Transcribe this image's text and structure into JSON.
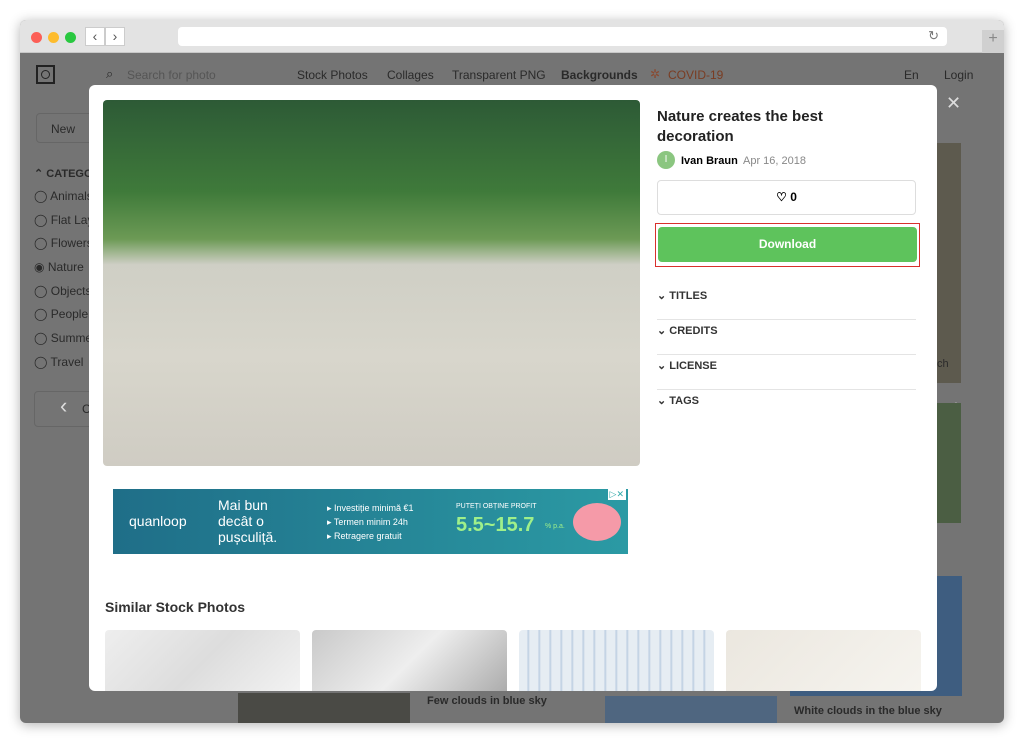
{
  "nav": {
    "search_placeholder": "Search for photo",
    "links": [
      "Stock Photos",
      "Collages",
      "Transparent PNG",
      "Backgrounds",
      "COVID-19"
    ],
    "lang": "En",
    "login": "Login"
  },
  "sidebar": {
    "new": "New",
    "categories_label": "CATEGO",
    "items": [
      "Animals",
      "Flat Lay",
      "Flowers",
      "Nature",
      "Objects",
      "People",
      "Summe",
      "Travel"
    ],
    "selected": "Nature",
    "button_partial": "C"
  },
  "background": {
    "captions": [
      "Few clouds in blue sky",
      "White clouds in the blue sky",
      "ch"
    ]
  },
  "modal": {
    "title": "Nature creates the best decoration",
    "author_initial": "I",
    "author": "Ivan Braun",
    "date": "Apr 16, 2018",
    "likes": "0",
    "download": "Download",
    "accordions": [
      "TITLES",
      "CREDITS",
      "LICENSE",
      "TAGS"
    ],
    "similar_heading": "Similar Stock Photos"
  },
  "ad": {
    "brand": "quanloop",
    "headline": [
      "Mai bun",
      "decât o",
      "pușculiță."
    ],
    "bullets": [
      "Investiție minimă €1",
      "Termen minim 24h",
      "Retragere gratuit"
    ],
    "profit_label": "PUTEȚI OBȚINE PROFIT",
    "rate": "5.5~15.7",
    "rate_unit": "% p.a."
  },
  "colors": {
    "download": "#5ec35c",
    "highlight": "#d9302c",
    "covid": "#c0572b"
  }
}
